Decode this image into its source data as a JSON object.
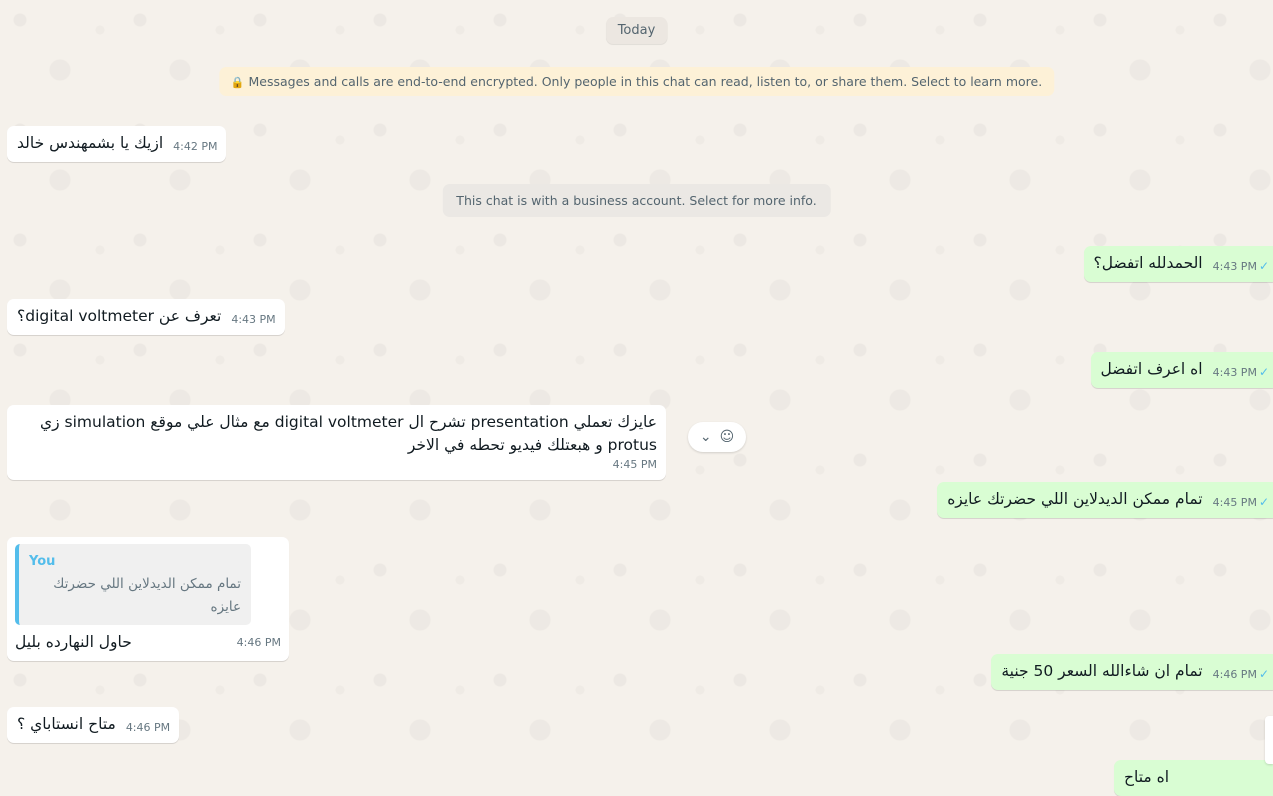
{
  "date_chip": "Today",
  "encryption_notice": "Messages and calls are end-to-end encrypted. Only people in this chat can read, listen to, or share them. Select to learn more.",
  "business_notice": "This chat is with a business account. Select for more info.",
  "messages": [
    {
      "dir": "in",
      "text": "ازيك يا بشمهندس خالد",
      "time": "4:42 PM"
    },
    {
      "dir": "out",
      "text": "الحمدلله اتفضل؟",
      "time": "4:43 PM"
    },
    {
      "dir": "in",
      "text": "تعرف عن digital voltmeter؟",
      "time": "4:43 PM"
    },
    {
      "dir": "out",
      "text": "اه اعرف اتفضل",
      "time": "4:43 PM"
    },
    {
      "dir": "in",
      "text": "عايزك تعملي presentation تشرح ال digital voltmeter مع مثال علي موقع simulation زي protus و هبعتلك فيديو تحطه في الاخر",
      "time": "4:45 PM"
    },
    {
      "dir": "out",
      "text": "تمام ممكن الديدلاين اللي حضرتك عايزه",
      "time": "4:45 PM"
    },
    {
      "dir": "in",
      "reply_author": "You",
      "reply_text": "تمام ممكن الديدلاين اللي حضرتك عايزه",
      "text": "حاول النهارده بليل",
      "time": "4:46 PM"
    },
    {
      "dir": "out",
      "text": "تمام ان شاءالله السعر 50 جنية",
      "time": "4:46 PM"
    },
    {
      "dir": "in",
      "text": "متاح انستاباي ؟",
      "time": "4:46 PM"
    },
    {
      "dir": "out",
      "text": "اه متاح",
      "time": ""
    }
  ],
  "tick_icon": "double-check-icon",
  "colors": {
    "incoming": "#ffffff",
    "outgoing": "#d9fdd3",
    "tick": "#53bdeb",
    "background": "#f5f1eb"
  }
}
